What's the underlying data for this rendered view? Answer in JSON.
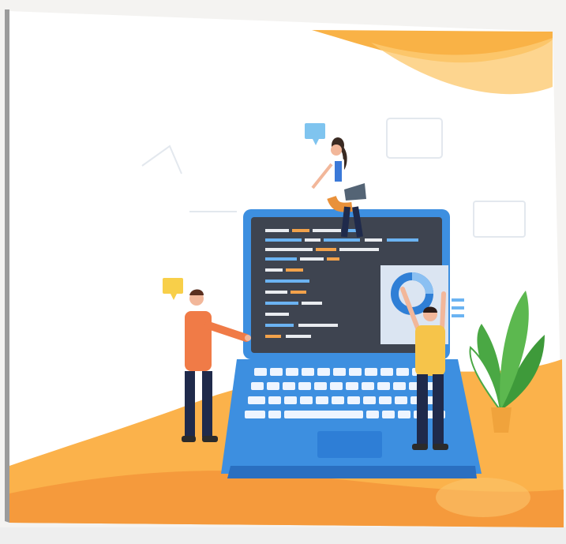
{
  "scene": {
    "subject": "illustration-developers-working-on-laptop",
    "colors": {
      "background": "#ffffff",
      "orange_light": "#fcb84a",
      "orange_deep": "#f58a33",
      "laptop_body": "#3d8fe0",
      "laptop_screen": "#3e4450",
      "keyboard": "#eef5ff",
      "chart_panel": "#d9e4f2",
      "plant_green": "#4aa844",
      "speech_bubble_blue": "#7fc4ef",
      "speech_bubble_yellow": "#f8cf49",
      "person_shirt_orange": "#f07b47",
      "person_shirt_yellow": "#f6c44a",
      "pants_navy": "#1f2a4b"
    },
    "icons": [
      "speech-bubble-icon",
      "donut-chart-icon",
      "code-editor-icon",
      "plant-icon"
    ]
  }
}
